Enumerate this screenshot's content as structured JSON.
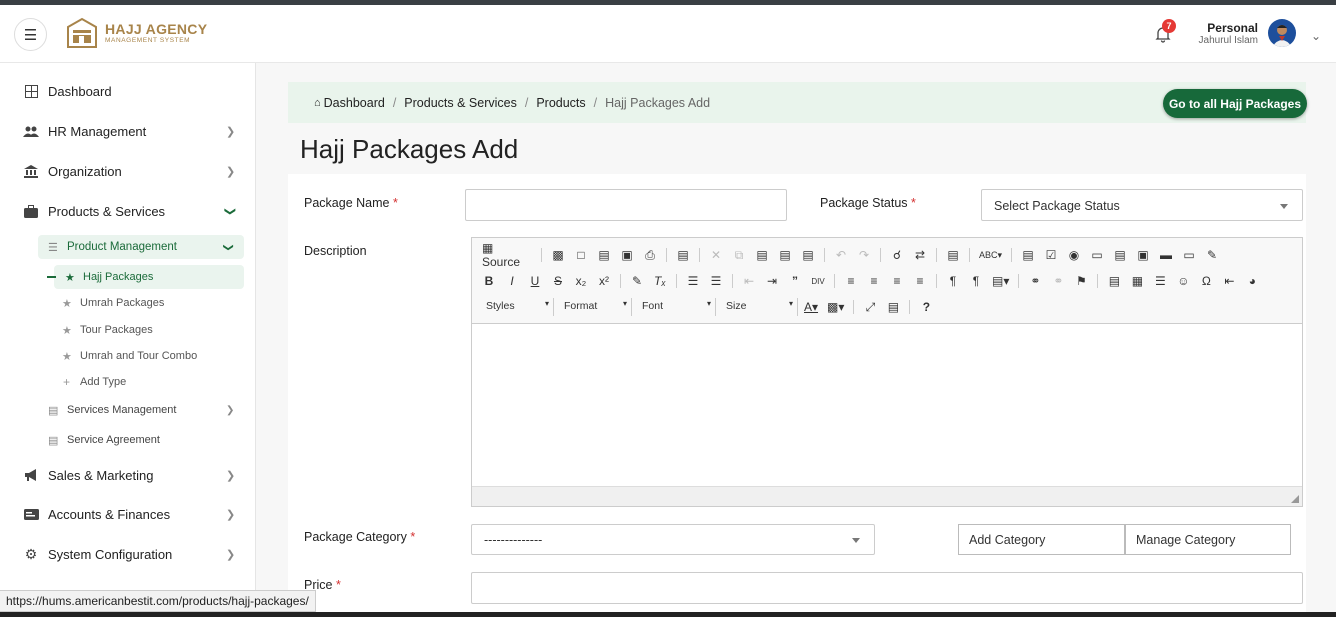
{
  "header": {
    "logo_title": "HAJJ AGENCY",
    "logo_subtitle": "MANAGEMENT SYSTEM",
    "notification_count": "7",
    "user_name": "Personal",
    "user_subtitle": "Jahurul Islam"
  },
  "sidebar": {
    "items": [
      {
        "label": "Dashboard",
        "icon": "grid-icon"
      },
      {
        "label": "HR Management",
        "icon": "people-icon"
      },
      {
        "label": "Organization",
        "icon": "bank-icon"
      },
      {
        "label": "Products & Services",
        "icon": "briefcase-icon"
      },
      {
        "label": "Sales & Marketing",
        "icon": "megaphone-icon"
      },
      {
        "label": "Accounts & Finances",
        "icon": "card-icon"
      },
      {
        "label": "System Configuration",
        "icon": "gear-icon"
      }
    ],
    "product_management": "Product Management",
    "sub_items": [
      "Hajj Packages",
      "Umrah Packages",
      "Tour Packages",
      "Umrah and Tour Combo",
      "Add Type"
    ],
    "services_management": "Services Management",
    "service_agreement": "Service Agreement"
  },
  "breadcrumb": {
    "items": [
      "Dashboard",
      "Products & Services",
      "Products"
    ],
    "current": "Hajj Packages Add",
    "separator": "/"
  },
  "go_button": "Go to all Hajj Packages",
  "page_title": "Hajj Packages Add",
  "form": {
    "package_name_label": "Package Name",
    "package_status_label": "Package Status",
    "package_status_placeholder": "Select Package Status",
    "description_label": "Description",
    "package_category_label": "Package Category",
    "package_category_value": "--------------",
    "add_category": "Add Category",
    "manage_category": "Manage Category",
    "price_label": "Price",
    "required_mark": "*"
  },
  "editor": {
    "source_label": "Source",
    "styles": "Styles",
    "format": "Format",
    "font": "Font",
    "size": "Size"
  },
  "status_url": "https://hums.americanbestit.com/products/hajj-packages/",
  "colors": {
    "primary_green": "#17693a",
    "active_bg": "#eaf4ee",
    "crumb_bg": "#e9f4ec",
    "brand_gold": "#a8844a",
    "badge_red": "#e53935"
  }
}
